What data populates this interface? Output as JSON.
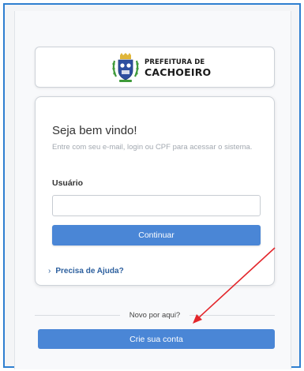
{
  "logo": {
    "line1": "PREFEITURA DE",
    "line2": "CACHOEIRO",
    "crest_icon": "municipal-crest-icon"
  },
  "login": {
    "welcome": "Seja bem vindo!",
    "subtitle": "Entre com seu e-mail, login ou CPF para acessar o sistema.",
    "user_label": "Usuário",
    "user_value": "",
    "continue_label": "Continuar",
    "help_label": "Precisa de Ajuda?",
    "help_icon": "chevron-right-icon"
  },
  "signup": {
    "divider_text": "Novo por aqui?",
    "create_label": "Crie sua conta"
  },
  "annotation": {
    "arrow_color": "#e3262b"
  },
  "colors": {
    "accent": "#4a86d6",
    "link": "#2c5f9e",
    "frame_border": "#2f7fd0"
  }
}
